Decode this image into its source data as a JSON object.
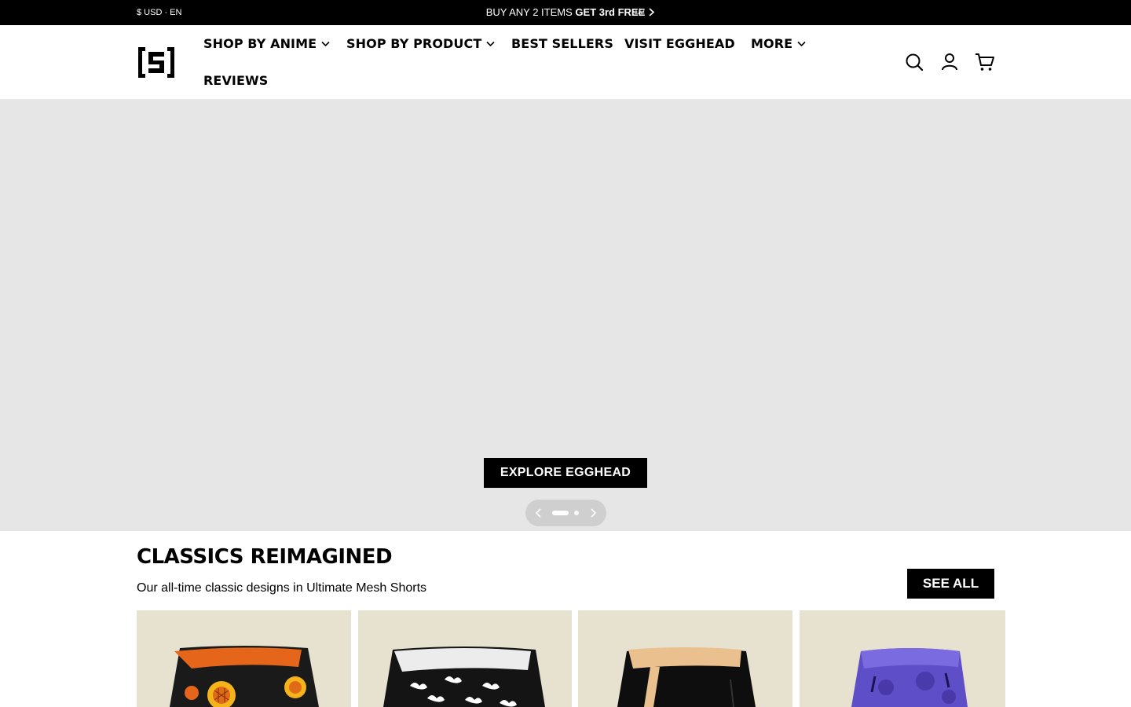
{
  "announcement": {
    "locale": "$ USD · EN",
    "promo_text": "BUY ANY 2 ITEMS",
    "promo_bold": "GET 3rd FREE",
    "pager": "1/2"
  },
  "header": {
    "logo_icon": "brand-bracket-s-logo",
    "nav": [
      {
        "label": "SHOP BY ANIME",
        "has_dropdown": true
      },
      {
        "label": "SHOP BY PRODUCT",
        "has_dropdown": true
      },
      {
        "label": "BEST SELLERS",
        "has_dropdown": false
      },
      {
        "label": "VISIT EGGHEAD",
        "has_dropdown": false
      },
      {
        "label": "MORE",
        "has_dropdown": true
      },
      {
        "label": "REVIEWS",
        "has_dropdown": false
      }
    ],
    "icons": [
      "search-icon",
      "account-icon",
      "cart-icon"
    ]
  },
  "hero": {
    "cta_label": "EXPLORE EGGHEAD",
    "slide_count": 2,
    "active_slide": 1
  },
  "section": {
    "title": "CLASSICS REIMAGINED",
    "subtitle": "Our all-time classic designs in Ultimate Mesh Shorts",
    "see_all_label": "SEE ALL"
  },
  "products": [
    {
      "image": "orange-sunflower-mesh-shorts"
    },
    {
      "image": "white-cloud-mesh-shorts"
    },
    {
      "image": "tan-black-mesh-shorts"
    },
    {
      "image": "purple-pattern-mesh-shorts"
    }
  ],
  "colors": {
    "bar": "#000000",
    "hero_bg": "#e6e6e6",
    "card_bg": "#e7e1cf"
  }
}
